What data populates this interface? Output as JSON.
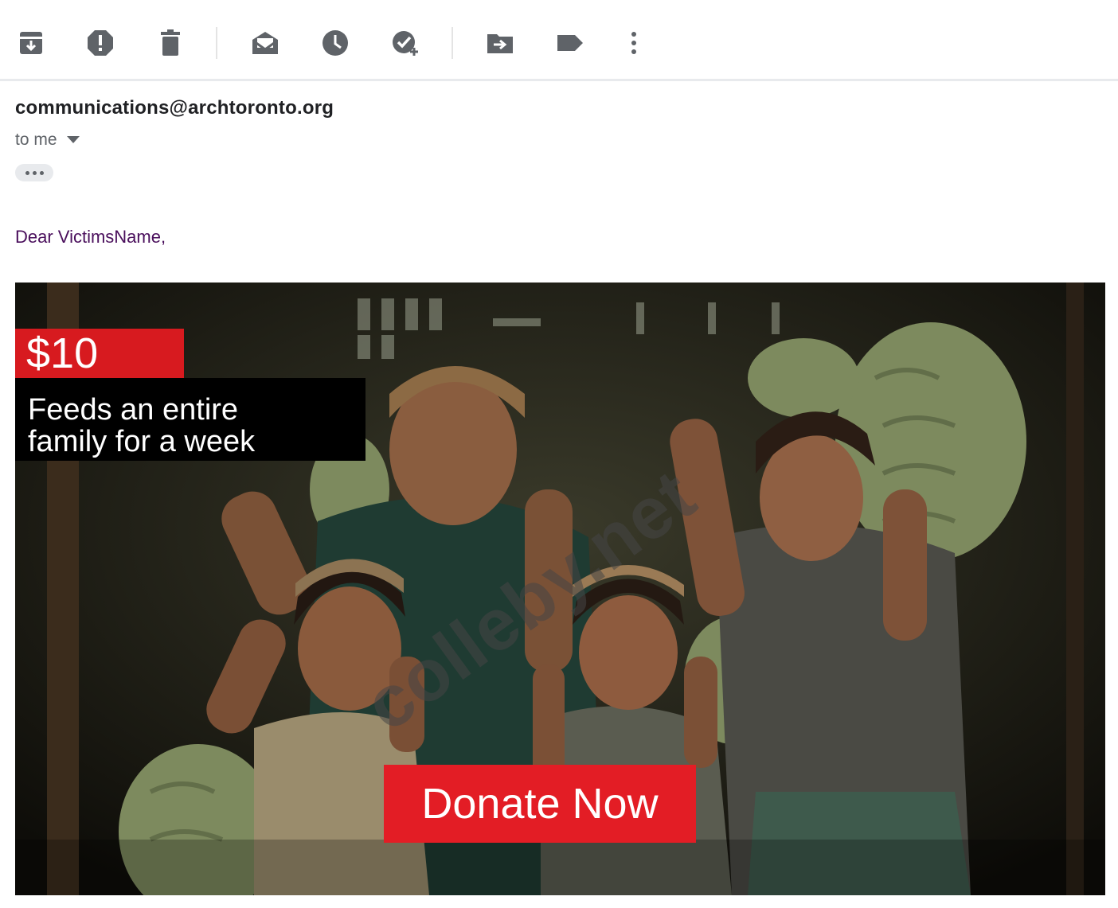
{
  "toolbar": {
    "buttons": [
      {
        "name": "archive-icon"
      },
      {
        "name": "report-spam-icon"
      },
      {
        "name": "delete-icon"
      },
      {
        "name": "mark-as-unread-icon"
      },
      {
        "name": "snooze-icon"
      },
      {
        "name": "add-to-tasks-icon"
      },
      {
        "name": "move-to-icon"
      },
      {
        "name": "label-icon"
      },
      {
        "name": "more-options-icon"
      }
    ]
  },
  "message": {
    "sender": "communications@archtoronto.org",
    "recipient": "to me",
    "greeting": "Dear VictimsName,"
  },
  "banner": {
    "price": "$10",
    "tagline_line1": "Feeds an entire",
    "tagline_line2": "family for a week",
    "cta": "Donate Now",
    "watermark": "colleby.net",
    "accent_color": "#e31d25"
  }
}
